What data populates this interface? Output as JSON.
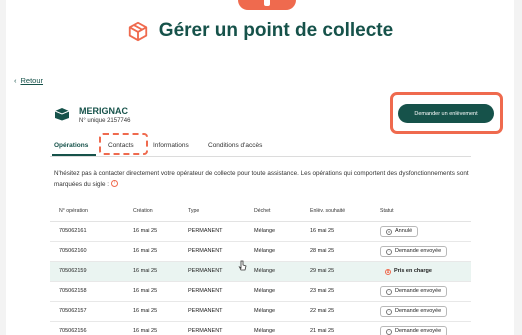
{
  "header": {
    "title": "Gérer un point de collecte"
  },
  "nav": {
    "back_label": "Retour"
  },
  "site": {
    "name": "MERIGNAC",
    "id_label": "N° unique 2157746"
  },
  "actions": {
    "request_pickup_label": "Demander un enlèvement"
  },
  "tabs": [
    {
      "label": "Opérations",
      "active": true
    },
    {
      "label": "Contacts",
      "active": false
    },
    {
      "label": "Informations",
      "active": false
    },
    {
      "label": "Conditions d'accès",
      "active": false
    }
  ],
  "info_text": "N'hésitez pas à contacter directement votre opérateur de collecte pour toute assistance. Les opérations qui comportent des dysfonctionnements sont marquées du sigle :",
  "table": {
    "columns": [
      "N° opération",
      "Création",
      "Type",
      "Déchet",
      "Enlèv. souhaité",
      "Statut"
    ],
    "rows": [
      {
        "op": "705062161",
        "created": "16 mai 25",
        "type": "PERMANENT",
        "waste": "Mélange",
        "wished": "16 mai 25",
        "status": "Annulé",
        "status_style": "neutral",
        "status_icon": "x-circle-icon"
      },
      {
        "op": "705062160",
        "created": "16 mai 25",
        "type": "PERMANENT",
        "waste": "Mélange",
        "wished": "28 mai 25",
        "status": "Demande envoyée",
        "status_style": "neutral",
        "status_icon": "clock-icon"
      },
      {
        "op": "705062159",
        "created": "16 mai 25",
        "type": "PERMANENT",
        "waste": "Mélange",
        "wished": "29 mai 25",
        "status": "Pris en charge",
        "status_style": "orange",
        "status_icon": "hourglass-icon"
      },
      {
        "op": "705062158",
        "created": "16 mai 25",
        "type": "PERMANENT",
        "waste": "Mélange",
        "wished": "23 mai 25",
        "status": "Demande envoyée",
        "status_style": "neutral",
        "status_icon": "clock-icon"
      },
      {
        "op": "705062157",
        "created": "16 mai 25",
        "type": "PERMANENT",
        "waste": "Mélange",
        "wished": "22 mai 25",
        "status": "Demande envoyée",
        "status_style": "neutral",
        "status_icon": "clock-icon"
      },
      {
        "op": "705062156",
        "created": "16 mai 25",
        "type": "PERMANENT",
        "waste": "Mélange",
        "wished": "21 mai 25",
        "status": "Demande envoyée",
        "status_style": "neutral",
        "status_icon": "clock-icon"
      }
    ]
  },
  "colors": {
    "brand": "#16524a",
    "accent": "#ef6a4e",
    "row_highlight": "#eaf4f1"
  }
}
